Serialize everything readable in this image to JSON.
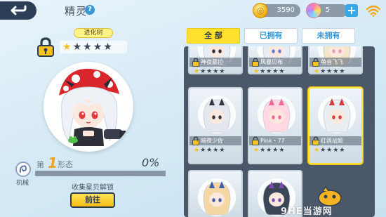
{
  "header": {
    "title": "精灵",
    "help_symbol": "?",
    "coins": "3590",
    "gems": "5",
    "plus": "+"
  },
  "colors": {
    "accent_yellow": "#ffe02d",
    "tab_blue": "#3a96d8",
    "progress_orange": "#f0a21a",
    "frame_dark": "#4a586a"
  },
  "icons": {
    "back": "back-arrow-icon",
    "help": "help-icon",
    "coin": "coin-icon",
    "gem": "gem-icon",
    "wifi": "wifi-icon",
    "lock": "lock-icon",
    "type": "mech-type-icon"
  },
  "sprite": {
    "evolution_tree_label": "进化树",
    "stars_filled": 1,
    "stars_total": 5,
    "form_prefix": "第",
    "form_number": "1",
    "form_suffix": "形态",
    "progress_percent": "0%",
    "progress_value": 0,
    "type_label": "机械",
    "unlock_hint": "收集星贝解锁",
    "goto_label": "前往"
  },
  "tabs": [
    {
      "label": "全 部",
      "active": true
    },
    {
      "label": "已拥有",
      "active": false
    },
    {
      "label": "未拥有",
      "active": false
    }
  ],
  "cards": [
    {
      "name": "神夜慕拉",
      "stars": 1,
      "locked": true,
      "selected": false,
      "hair": "#e6edf4",
      "accent": "#2d2d3a"
    },
    {
      "name": "风暴贝布",
      "stars": 1,
      "locked": true,
      "selected": false,
      "hair": "#e6edf4",
      "accent": "#6b7bd8"
    },
    {
      "name": "萌音飞飞",
      "stars": 1,
      "locked": true,
      "selected": false,
      "hair": "#f2e5c8",
      "accent": "#e89ab3"
    },
    {
      "name": "暗夜少佐",
      "stars": 1,
      "locked": true,
      "selected": false,
      "hair": "#e4e8ee",
      "accent": "#30343f"
    },
    {
      "name": "Pink・77",
      "stars": 1,
      "locked": true,
      "selected": false,
      "hair": "#ffd8e4",
      "accent": "#f06a97"
    },
    {
      "name": "红莲战姬",
      "stars": 1,
      "locked": true,
      "selected": true,
      "hair": "#e9eef3",
      "accent": "#d23b3b"
    },
    {
      "name": "",
      "stars": 0,
      "locked": false,
      "selected": false,
      "hair": "#f4d7a2",
      "accent": "#3b5ea8"
    },
    {
      "name": "",
      "stars": 0,
      "locked": false,
      "selected": false,
      "hair": "#3b4656",
      "accent": "#7e4ab3"
    }
  ],
  "watermark": {
    "text": "9HE当游网"
  }
}
